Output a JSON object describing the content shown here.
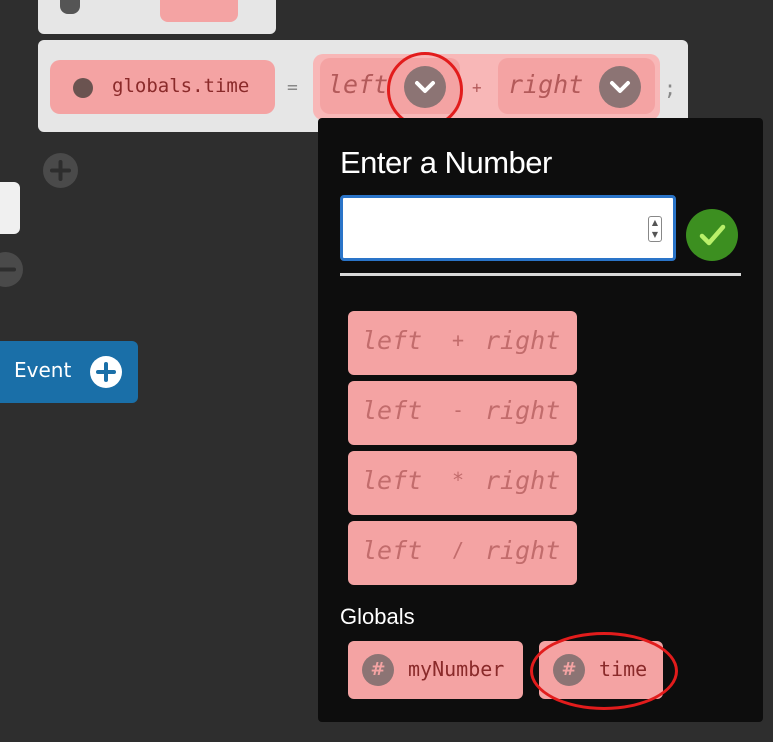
{
  "statement": {
    "variable": "globals.time",
    "equals": "=",
    "left_operand": "left",
    "operator": "+",
    "right_operand": "right",
    "terminator": ";"
  },
  "sidebar": {
    "event_label": "Event"
  },
  "popup": {
    "title": "Enter a Number",
    "input": {
      "value": "",
      "placeholder": ""
    },
    "options": [
      {
        "left": "left",
        "op": "+",
        "right": "right"
      },
      {
        "left": "left",
        "op": "-",
        "right": "right"
      },
      {
        "left": "left",
        "op": "*",
        "right": "right"
      },
      {
        "left": "left",
        "op": "/",
        "right": "right"
      }
    ],
    "globals_label": "Globals",
    "globals": [
      {
        "icon": "#",
        "name": "myNumber"
      },
      {
        "icon": "#",
        "name": "time"
      }
    ]
  },
  "colors": {
    "background": "#2e2e2e",
    "block": "#e6e6e6",
    "chip_pink": "#f4a3a3",
    "popup_bg": "#0d0d0d",
    "accent_blue": "#1a6fa8",
    "ok_green": "#3c8f20",
    "highlight_red": "#e21c1c"
  },
  "icons": [
    "chevron-down-icon",
    "check-icon",
    "plus-icon",
    "hash-icon"
  ]
}
